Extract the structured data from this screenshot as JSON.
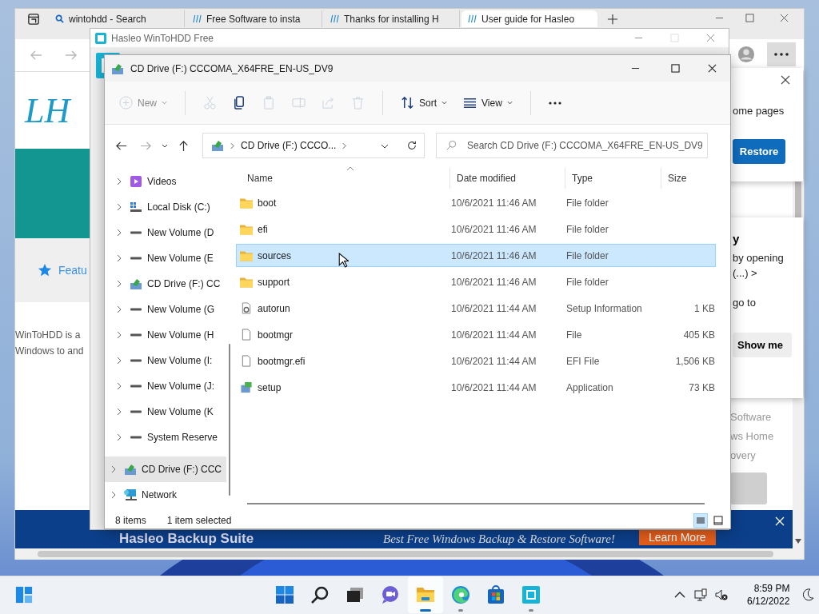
{
  "browser": {
    "tabs": [
      {
        "label": "wintohdd - Search",
        "kind": "search",
        "selected": false
      },
      {
        "label": "Free Software to insta",
        "kind": "site",
        "selected": false
      },
      {
        "label": "Thanks for installing H",
        "kind": "site",
        "selected": false
      },
      {
        "label": "User guide for Hasleo",
        "kind": "site",
        "selected": true
      }
    ],
    "page": {
      "logo": "LH",
      "features_link": "Featu",
      "intro_lines": [
        "WinToHDD is a",
        "Windows to and"
      ],
      "side_links": [
        "Software",
        "ws Home",
        "overy"
      ],
      "banner": {
        "title": "Hasleo Backup Suite",
        "tagline": "Best Free Windows Backup & Restore Software!",
        "button": "Learn More"
      }
    },
    "restore_popup": {
      "text": "ome pages",
      "button": "Restore"
    },
    "tip_popup": {
      "heading": "y",
      "lines": [
        "by opening",
        "(...) >",
        "go to"
      ],
      "button": "Show me"
    }
  },
  "app_window": {
    "title": "Hasleo WinToHDD Free"
  },
  "explorer": {
    "title": "CD Drive (F:) CCCOMA_X64FRE_EN-US_DV9",
    "toolbar": [
      {
        "kind": "new",
        "label": "New",
        "disabled": true
      },
      {
        "kind": "cut",
        "disabled": true
      },
      {
        "kind": "copy",
        "disabled": false
      },
      {
        "kind": "paste",
        "disabled": true
      },
      {
        "kind": "rename",
        "disabled": true
      },
      {
        "kind": "share",
        "disabled": true
      },
      {
        "kind": "delete",
        "disabled": true
      },
      {
        "kind": "sort",
        "label": "Sort",
        "disabled": false
      },
      {
        "kind": "view",
        "label": "View",
        "disabled": false
      },
      {
        "kind": "more",
        "disabled": false
      }
    ],
    "address": "CD Drive (F:) CCCO...",
    "search": {
      "placeholder": "Search CD Drive (F:) CCCOMA_X64FRE_EN-US_DV9"
    },
    "nav_pane": {
      "this_pc": [
        {
          "label": "Videos",
          "kind": "videos",
          "selected": false
        },
        {
          "label": "Local Disk (C:)",
          "kind": "system",
          "selected": false
        },
        {
          "label": "New Volume (D",
          "kind": "drive",
          "selected": false
        },
        {
          "label": "New Volume (E",
          "kind": "drive",
          "selected": false
        },
        {
          "label": "CD Drive (F:) CC",
          "kind": "cd",
          "selected": false
        },
        {
          "label": "New Volume (G",
          "kind": "drive",
          "selected": false
        },
        {
          "label": "New Volume (H",
          "kind": "drive",
          "selected": false
        },
        {
          "label": "New Volume (I:",
          "kind": "drive",
          "selected": false
        },
        {
          "label": "New Volume (J:",
          "kind": "drive",
          "selected": false
        },
        {
          "label": "New Volume (K",
          "kind": "drive",
          "selected": false
        },
        {
          "label": "System Reserve",
          "kind": "drive",
          "selected": false
        }
      ],
      "top_level": [
        {
          "label": "CD Drive (F:) CCC",
          "kind": "cd",
          "selected": true
        },
        {
          "label": "Network",
          "kind": "network",
          "selected": false
        }
      ]
    },
    "columns": [
      "Name",
      "Date modified",
      "Type",
      "Size"
    ],
    "files": [
      {
        "name": "boot",
        "date": "10/6/2021 11:46 AM",
        "type": "File folder",
        "kind": "folder",
        "selected": false
      },
      {
        "name": "efi",
        "date": "10/6/2021 11:46 AM",
        "type": "File folder",
        "kind": "folder",
        "selected": false
      },
      {
        "name": "sources",
        "date": "10/6/2021 11:46 AM",
        "type": "File folder",
        "kind": "folder",
        "selected": true
      },
      {
        "name": "support",
        "date": "10/6/2021 11:46 AM",
        "type": "File folder",
        "kind": "folder",
        "selected": false
      },
      {
        "name": "autorun",
        "date": "10/6/2021 11:44 AM",
        "type": "Setup Information",
        "size": "1 KB",
        "kind": "settings",
        "selected": false
      },
      {
        "name": "bootmgr",
        "date": "10/6/2021 11:44 AM",
        "type": "File",
        "size": "405 KB",
        "kind": "file",
        "selected": false
      },
      {
        "name": "bootmgr.efi",
        "date": "10/6/2021 11:44 AM",
        "type": "EFI File",
        "size": "1,506 KB",
        "kind": "file",
        "selected": false
      },
      {
        "name": "setup",
        "date": "10/6/2021 11:44 AM",
        "type": "Application",
        "size": "73 KB",
        "kind": "app",
        "selected": false
      }
    ],
    "status": {
      "count": "8 items",
      "selection": "1 item selected"
    },
    "view_modes": [
      {
        "kind": "details",
        "selected": true
      },
      {
        "kind": "tiles",
        "selected": false
      }
    ]
  },
  "taskbar": {
    "apps": [
      {
        "kind": "start",
        "running": false,
        "active": false
      },
      {
        "kind": "search",
        "running": false,
        "active": false
      },
      {
        "kind": "taskview",
        "running": false,
        "active": false
      },
      {
        "kind": "chat",
        "running": false,
        "active": false
      },
      {
        "kind": "explorer",
        "running": true,
        "active": true
      },
      {
        "kind": "edge",
        "running": true,
        "active": false
      },
      {
        "kind": "store",
        "running": false,
        "active": false
      },
      {
        "kind": "wintohdd",
        "running": true,
        "active": false
      }
    ],
    "clock": {
      "time": "8:59 PM",
      "date": "6/12/2022"
    }
  }
}
